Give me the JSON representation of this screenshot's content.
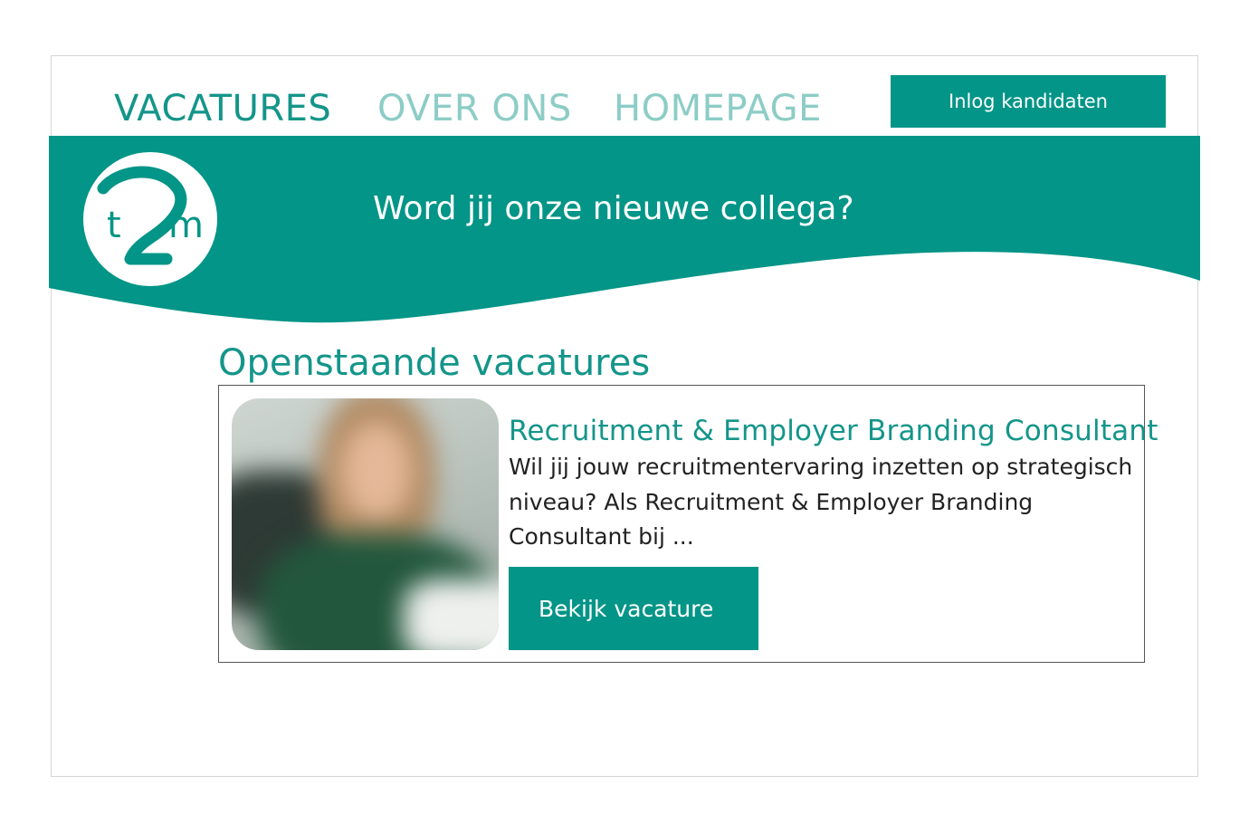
{
  "nav": {
    "items": [
      {
        "label": "VACATURES"
      },
      {
        "label": "OVER ONS"
      },
      {
        "label": "HOMEPAGE"
      }
    ],
    "login_label": "Inlog kandidaten"
  },
  "banner": {
    "tagline": "Word jij onze nieuwe collega?",
    "logo_text": "t2m"
  },
  "main": {
    "section_title": "Openstaande vacatures",
    "jobs": [
      {
        "title": "Recruitment & Employer Branding Consultant",
        "description": "Wil jij jouw recruitmentervaring inzetten op strategisch niveau? Als Recruitment & Employer Branding Consultant bij ...",
        "button_label": "Bekijk vacature"
      }
    ]
  },
  "colors": {
    "brand": "#039587",
    "nav_active": "#14958a",
    "nav_inactive": "#8ccdc6"
  }
}
